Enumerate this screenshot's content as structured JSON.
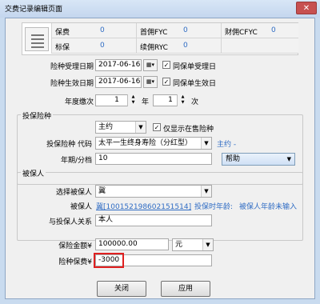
{
  "window": {
    "title": "交费记录编辑页面",
    "close": "✕"
  },
  "summary": {
    "row1": [
      {
        "label": "保费",
        "value": "0"
      },
      {
        "label": "首佣FYC",
        "value": "0"
      },
      {
        "label": "财佣CFYC",
        "value": "0"
      }
    ],
    "row2": [
      {
        "label": "标保",
        "value": "0"
      },
      {
        "label": "续佣RYC",
        "value": "0"
      }
    ]
  },
  "form": {
    "accept_date": {
      "label": "险种受理日期",
      "value": "2017-06-16",
      "same_label": "同保单受理日",
      "same_checked": true
    },
    "effective_date": {
      "label": "险种生效日期",
      "value": "2017-06-16",
      "same_label": "同保单生效日",
      "same_checked": true
    },
    "pay_count": {
      "label": "年度缴次",
      "year_value": "1",
      "year_unit": "年",
      "times_value": "1",
      "times_unit": "次"
    }
  },
  "insure_group": {
    "title": "投保险种",
    "main_select": "主约",
    "only_show_label": "仅显示在售险种",
    "only_show_checked": true,
    "product_label": "投保险种 代码",
    "product_value": "太平一生终身寿险（分红型）",
    "product_tag": "主约 -",
    "period_label": "年期/分档",
    "period_value": "10",
    "help_label": "帮助",
    "help_arrow": "▼"
  },
  "insured_group": {
    "title": "被保人",
    "choose_label": "选择被保人",
    "choose_value": "冀",
    "insured_label": "被保人",
    "insured_link": "冀[100152198602151514]",
    "age_at_insure": "投保时年龄:",
    "age_insured": "被保人年龄未输入",
    "relation_label": "与投保人关系",
    "relation_value": "本人"
  },
  "amount": {
    "sum_label": "保险金额¥",
    "sum_value": "100000.00",
    "unit_value": "元",
    "premium_label": "险种保费¥",
    "premium_value": "-3000"
  },
  "buttons": {
    "close": "关闭",
    "apply": "应用"
  },
  "icons": {
    "calendar": "calendar-icon",
    "dropdown": "▼",
    "check": "✓",
    "spin_up": "▲",
    "spin_down": "▼"
  },
  "colors": {
    "link": "#2f6cc4",
    "highlight": "#e02020"
  }
}
